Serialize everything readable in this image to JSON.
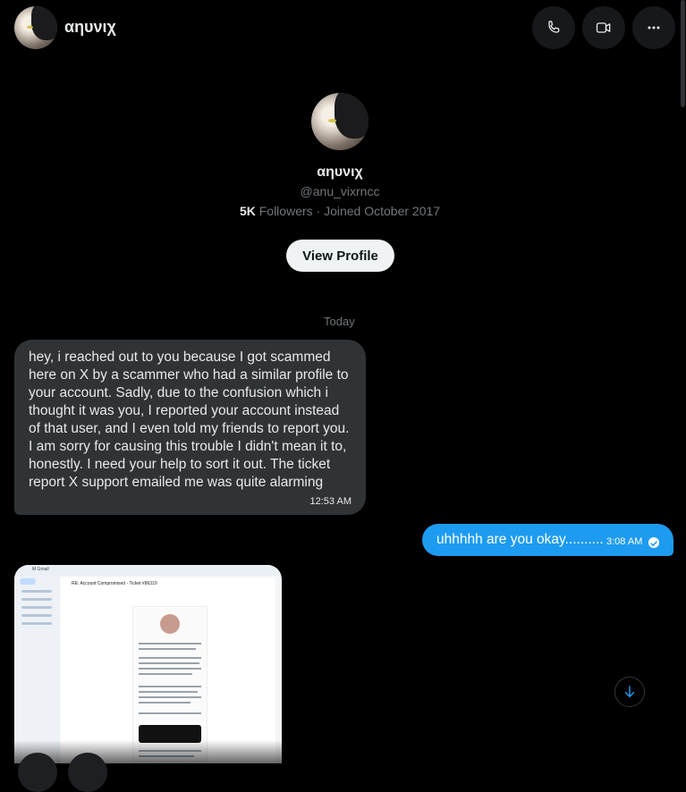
{
  "header": {
    "name": "αηυνιχ",
    "icons": [
      "phone-icon",
      "video-icon",
      "more-icon"
    ]
  },
  "profile": {
    "name": "αηυνιχ",
    "handle": "@anu_vixrncc",
    "followers_count": "5K",
    "followers_label": "Followers",
    "joined": " · Joined October 2017",
    "view_profile_label": "View Profile"
  },
  "divider_label": "Today",
  "messages": [
    {
      "direction": "incoming",
      "text": "hey, i reached out to you because I got scammed here on X by a scammer who had a similar profile to your account. Sadly, due to the confusion which i thought it was you, I reported your account instead of that user, and I even told my friends to report you. I am sorry for causing this trouble I didn't mean it to, honestly. I need your help to sort it out. The ticket report X support emailed me was quite alarming",
      "time": "12:53 AM"
    },
    {
      "direction": "outgoing",
      "text": "uhhhhh are you okay..........",
      "time": "3:08 AM",
      "status": "read"
    }
  ],
  "attachment": {
    "app_label": "M Gmail",
    "subject": "RE: Account Compromised - Ticket #86319"
  },
  "colors": {
    "accent": "#1d9bf0",
    "incoming_bubble": "#2f3336",
    "background": "#000000",
    "muted_text": "#71767b"
  }
}
